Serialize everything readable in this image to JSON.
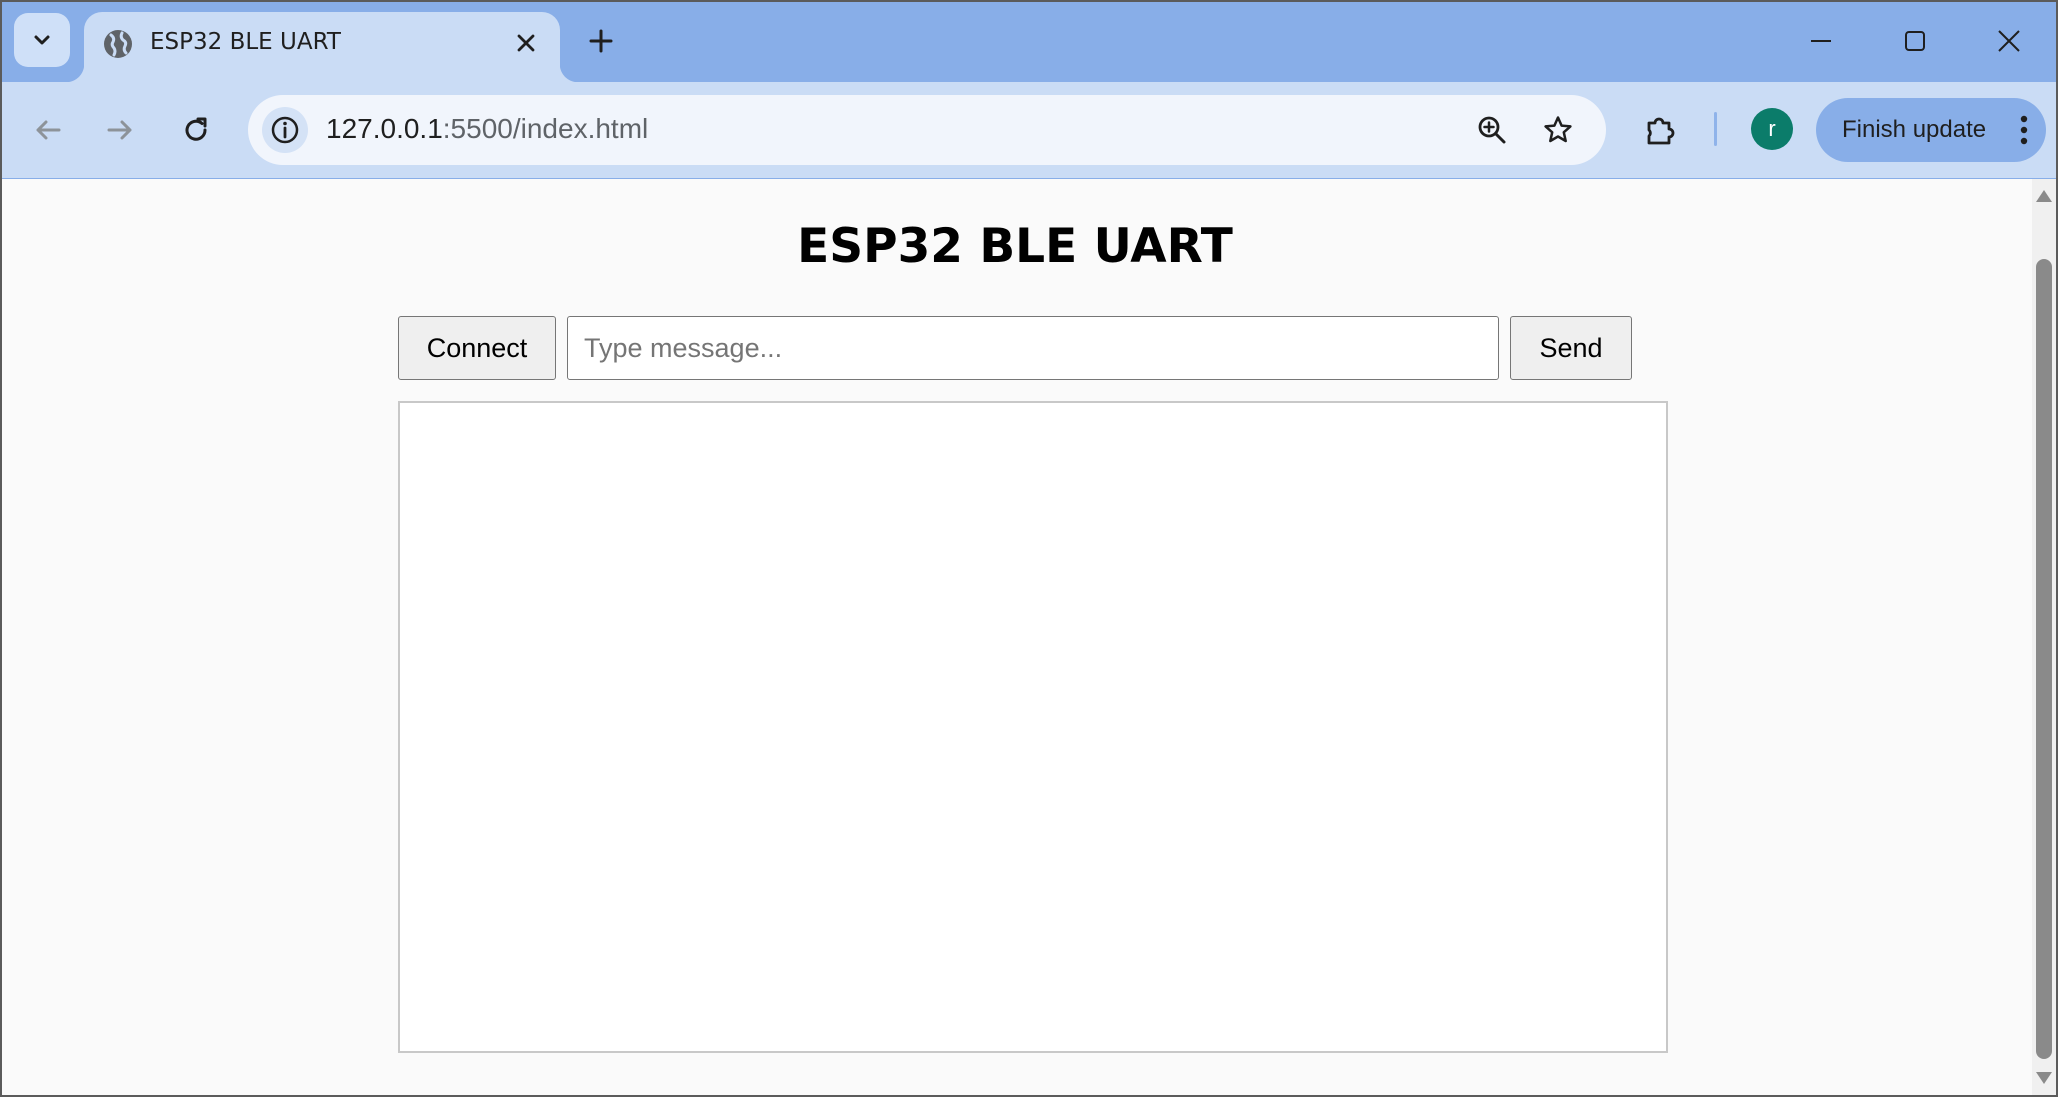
{
  "browser": {
    "tab": {
      "title": "ESP32 BLE UART",
      "favicon": "globe-icon",
      "close_icon": "close-icon"
    },
    "tab_search_icon": "chevron-down-icon",
    "new_tab_icon": "plus-icon",
    "window_controls": [
      "minimize-icon",
      "maximize-icon",
      "close-icon"
    ],
    "toolbar": {
      "back_icon": "arrow-left-icon",
      "forward_icon": "arrow-right-icon",
      "reload_icon": "reload-icon",
      "url_host": "127.0.0.1",
      "url_rest": ":5500/index.html",
      "zoom_icon": "zoom-in-icon",
      "bookmark_icon": "star-icon",
      "extensions_icon": "puzzle-icon",
      "profile_initial": "r",
      "finish_update_label": "Finish update",
      "menu_icon": "more-vertical-icon"
    },
    "colors": {
      "frame": "#88aee8",
      "toolbar": "#cadcf5",
      "avatar": "#0b7c6a"
    }
  },
  "page": {
    "title": "ESP32 BLE UART",
    "connect_label": "Connect",
    "message_placeholder": "Type message...",
    "message_value": "",
    "send_label": "Send",
    "log_text": ""
  }
}
